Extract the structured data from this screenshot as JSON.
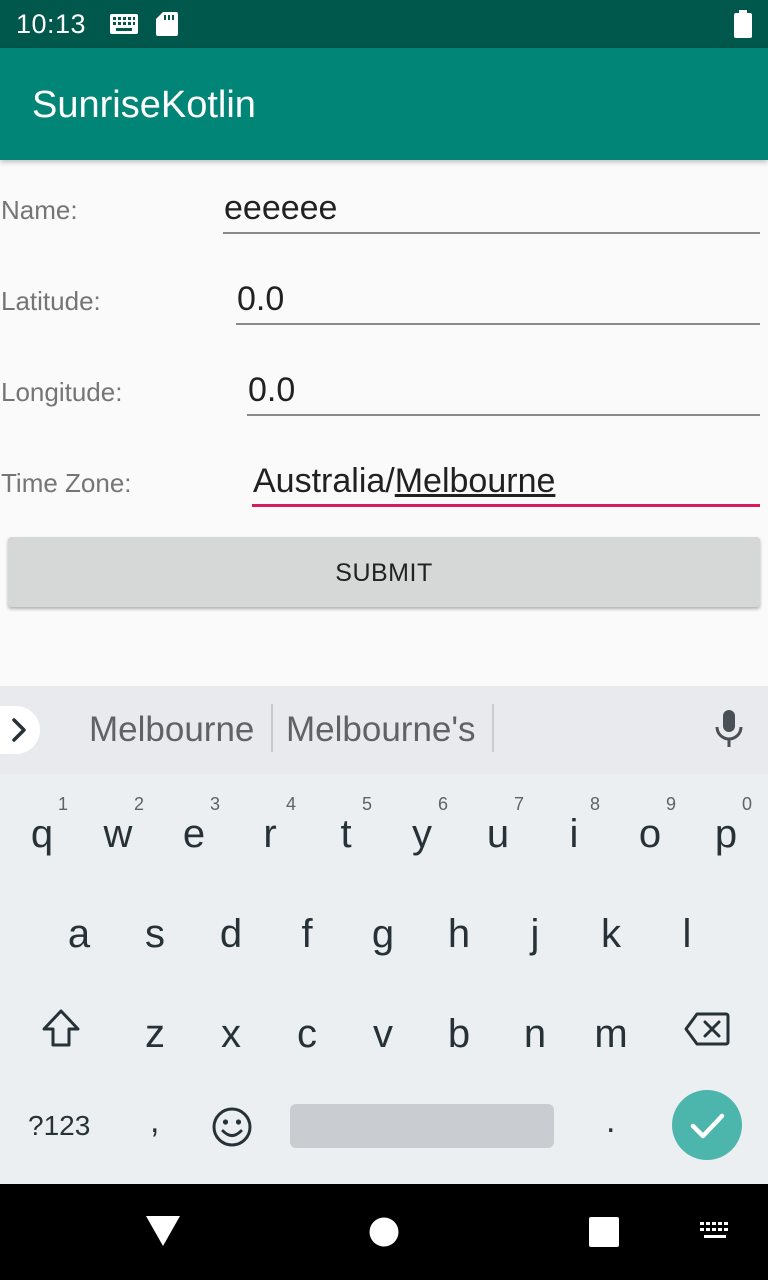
{
  "status_bar": {
    "time": "10:13"
  },
  "app_bar": {
    "title": "SunriseKotlin"
  },
  "form": {
    "name_label": "Name:",
    "name_value": "eeeeee",
    "latitude_label": "Latitude:",
    "latitude_value": "0.0",
    "longitude_label": "Longitude:",
    "longitude_value": "0.0",
    "timezone_label": "Time Zone:",
    "timezone_prefix": "Australia/",
    "timezone_composing": "Melbourne",
    "submit_label": "SUBMIT"
  },
  "keyboard": {
    "suggestions": [
      "Melbourne",
      "Melbourne's"
    ],
    "row1": [
      {
        "key": "q",
        "hint": "1"
      },
      {
        "key": "w",
        "hint": "2"
      },
      {
        "key": "e",
        "hint": "3"
      },
      {
        "key": "r",
        "hint": "4"
      },
      {
        "key": "t",
        "hint": "5"
      },
      {
        "key": "y",
        "hint": "6"
      },
      {
        "key": "u",
        "hint": "7"
      },
      {
        "key": "i",
        "hint": "8"
      },
      {
        "key": "o",
        "hint": "9"
      },
      {
        "key": "p",
        "hint": "0"
      }
    ],
    "row2": [
      "a",
      "s",
      "d",
      "f",
      "g",
      "h",
      "j",
      "k",
      "l"
    ],
    "row3": [
      "z",
      "x",
      "c",
      "v",
      "b",
      "n",
      "m"
    ],
    "symbols_label": "?123",
    "comma": ",",
    "period": "."
  },
  "icons": {
    "accent": "#008577",
    "status_bar_color": "#00574b",
    "focus_underline": "#d81b60",
    "enter_color": "#4db6ac"
  }
}
